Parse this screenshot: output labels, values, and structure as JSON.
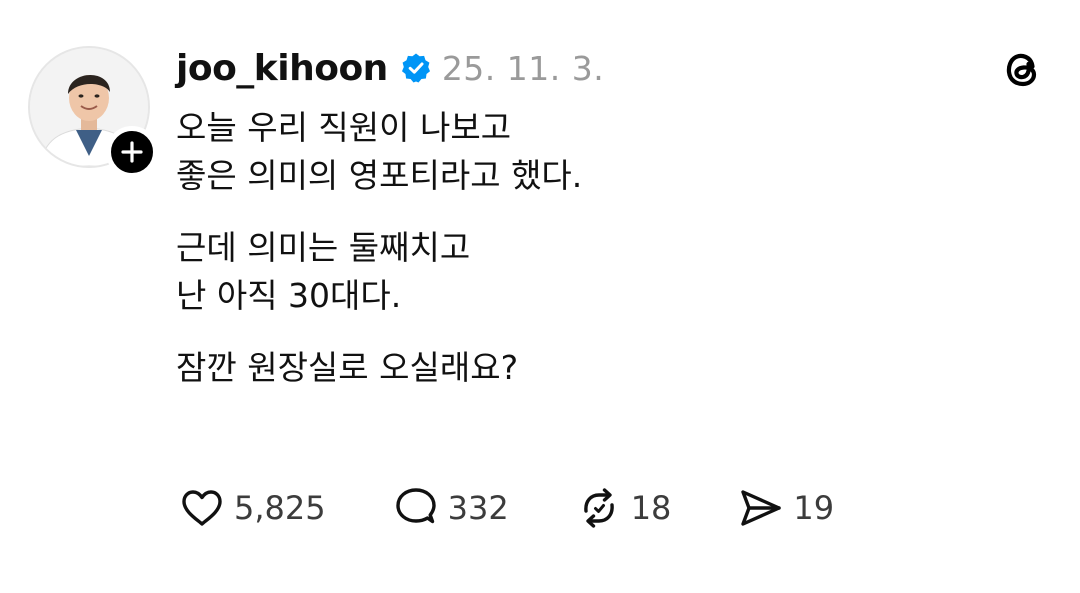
{
  "post": {
    "username": "joo_kihoon",
    "timestamp": "25. 11. 3.",
    "paragraphs": [
      "오늘 우리 직원이 나보고\n좋은 의미의 영포티라고 했다.",
      "근데 의미는 둘째치고\n난 아직 30대다.",
      "잠깐 원장실로 오실래요?"
    ]
  },
  "actions": {
    "likes": "5,825",
    "replies": "332",
    "reposts": "18",
    "shares": "19"
  },
  "icons": {
    "verified": "verified-badge-icon",
    "app": "threads-logo-icon",
    "follow": "plus-icon",
    "like": "heart-icon",
    "reply": "comment-bubble-icon",
    "repost": "repost-icon",
    "share": "send-icon"
  },
  "colors": {
    "verified": "#0095f6",
    "text": "#111111",
    "muted": "#9a9a9a"
  }
}
